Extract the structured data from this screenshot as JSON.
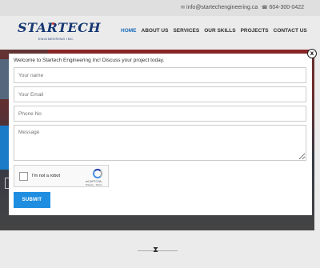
{
  "topbar": {
    "email": "info@startechengineering.ca",
    "phone": "604-300-0422",
    "email_icon": "envelope-icon",
    "phone_icon": "phone-icon"
  },
  "logo": {
    "text": "STARTECH",
    "sub": "ENGINEERING INC."
  },
  "nav": {
    "items": [
      {
        "label": "HOME",
        "active": true
      },
      {
        "label": "ABOUT US"
      },
      {
        "label": "SERVICES"
      },
      {
        "label": "OUR SKILLS"
      },
      {
        "label": "PROJECTS"
      },
      {
        "label": "CONTACT US"
      }
    ]
  },
  "modal": {
    "close": "x",
    "welcome": "Welcome to Startech Engineering Inc! Discuss your project today.",
    "name_placeholder": "Your name",
    "email_placeholder": "Your Email",
    "phone_placeholder": "Phone No",
    "message_placeholder": "Message",
    "recaptcha_label": "I'm not a robot",
    "recaptcha_brand": "reCAPTCHA",
    "recaptcha_terms": "Privacy - Terms",
    "submit_label": "SUBMIT"
  },
  "colors": {
    "accent": "#1f8ee0",
    "brand": "#1a3d7c"
  }
}
